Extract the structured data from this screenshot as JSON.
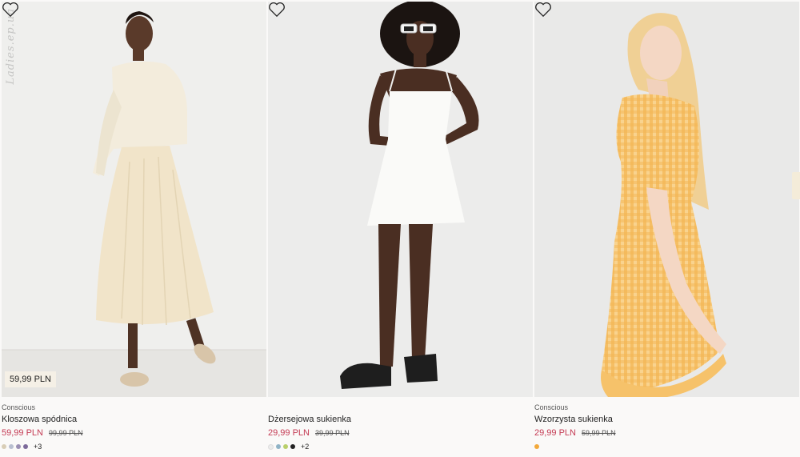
{
  "watermark": "Ladies.ep.ua",
  "products": [
    {
      "tag": "Conscious",
      "name": "Kloszowa spódnica",
      "price": "59,99 PLN",
      "old_price": "99,99 PLN",
      "badge": "59,99 PLN",
      "swatches": [
        "#d8cdb6",
        "#b9bfd0",
        "#9a8fb3",
        "#7c6a9a"
      ],
      "more": "+3"
    },
    {
      "tag": "",
      "name": "Dżersejowa sukienka",
      "price": "29,99 PLN",
      "old_price": "39,99 PLN",
      "swatches": [
        "#ececec",
        "#8fb3c6",
        "#b9cf6a",
        "#222222"
      ],
      "more": "+2"
    },
    {
      "tag": "Conscious",
      "name": "Wzorzysta sukienka",
      "price": "29,99 PLN",
      "old_price": "59,99 PLN",
      "swatches": [
        "#f2a93b"
      ],
      "more": ""
    }
  ],
  "colors": {
    "sale_price": "#c43a53"
  }
}
